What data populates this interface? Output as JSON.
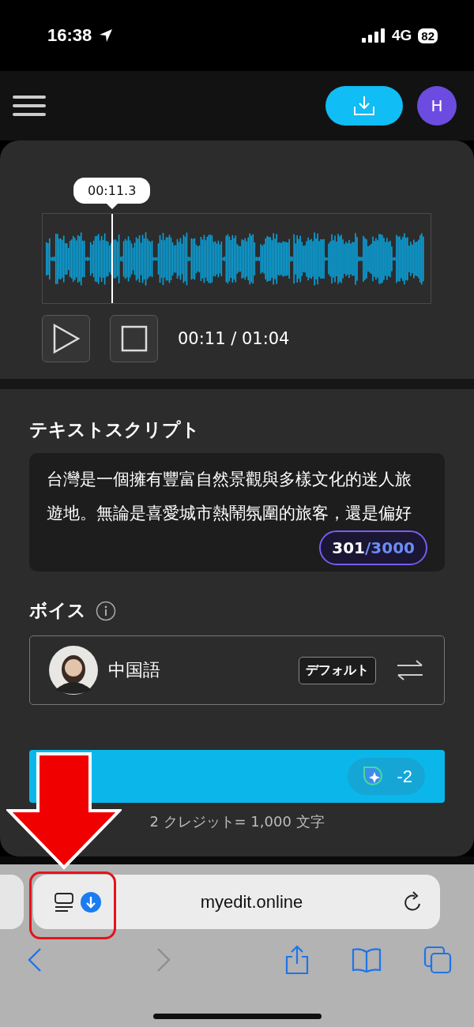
{
  "status_bar": {
    "time": "16:38",
    "network": "4G",
    "battery": "82"
  },
  "user": {
    "initial": "H"
  },
  "player": {
    "tooltip": "00:11.3",
    "playhead": {
      "level": 0.177
    },
    "time": "00:11 / 01:04"
  },
  "script": {
    "title": "テキストスクリプト",
    "text": "台灣是一個擁有豐富自然景觀與多樣文化的迷人旅遊地。無論是喜愛城市熱鬧氛圍的旅客，還是偏好",
    "used": "301",
    "total": "/3000"
  },
  "voice": {
    "title": "ボイス",
    "name": "中国語",
    "tag": "デフォルト"
  },
  "generate": {
    "credits": "-2",
    "note": "2 クレジット= 1,000 文字"
  },
  "browser": {
    "url": "myedit.online",
    "back_disabled": false,
    "forward_disabled": true
  }
}
